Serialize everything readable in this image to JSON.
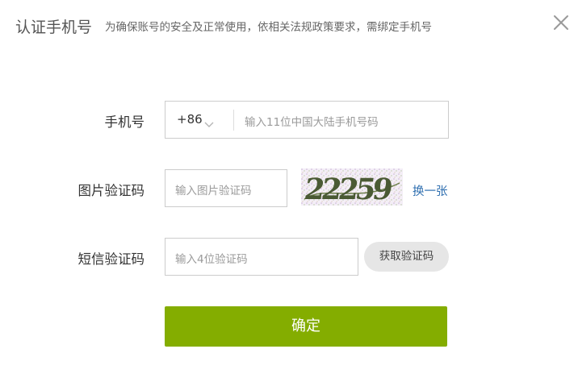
{
  "header": {
    "title": "认证手机号",
    "subtitle": "为确保账号的安全及正常使用，依相关法规政策要求，需绑定手机号",
    "close_icon": "close-icon"
  },
  "form": {
    "phone": {
      "label": "手机号",
      "country_code": "+86",
      "placeholder": "输入11位中国大陆手机号码"
    },
    "captcha": {
      "label": "图片验证码",
      "placeholder": "输入图片验证码",
      "image_text": "22259",
      "refresh_label": "换一张"
    },
    "sms": {
      "label": "短信验证码",
      "placeholder": "输入4位验证码",
      "get_code_label": "获取验证码"
    },
    "submit_label": "确定"
  },
  "colors": {
    "accent": "#84ad00",
    "link": "#2f6fb0",
    "border": "#cccccc",
    "placeholder": "#9a9a9a"
  }
}
